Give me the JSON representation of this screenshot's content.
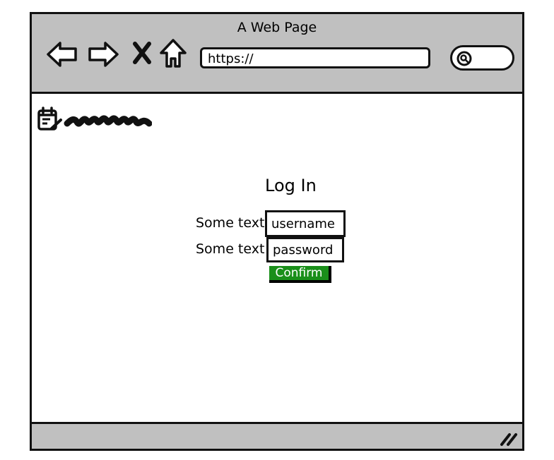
{
  "window": {
    "title": "A Web Page"
  },
  "toolbar": {
    "back_icon": "arrow-left-icon",
    "forward_icon": "arrow-right-icon",
    "stop_icon": "close-x-icon",
    "home_icon": "home-icon",
    "url_value": "https://",
    "search_icon": "search-icon"
  },
  "content": {
    "logo_icon": "edit-calendar-icon",
    "login": {
      "title": "Log In",
      "username_label": "Some text",
      "username_value": "username",
      "password_label": "Some text",
      "password_value": "password",
      "confirm_label": "Confirm"
    }
  },
  "colors": {
    "chrome": "#c0c0c0",
    "confirm_button": "#1a8f1a"
  }
}
